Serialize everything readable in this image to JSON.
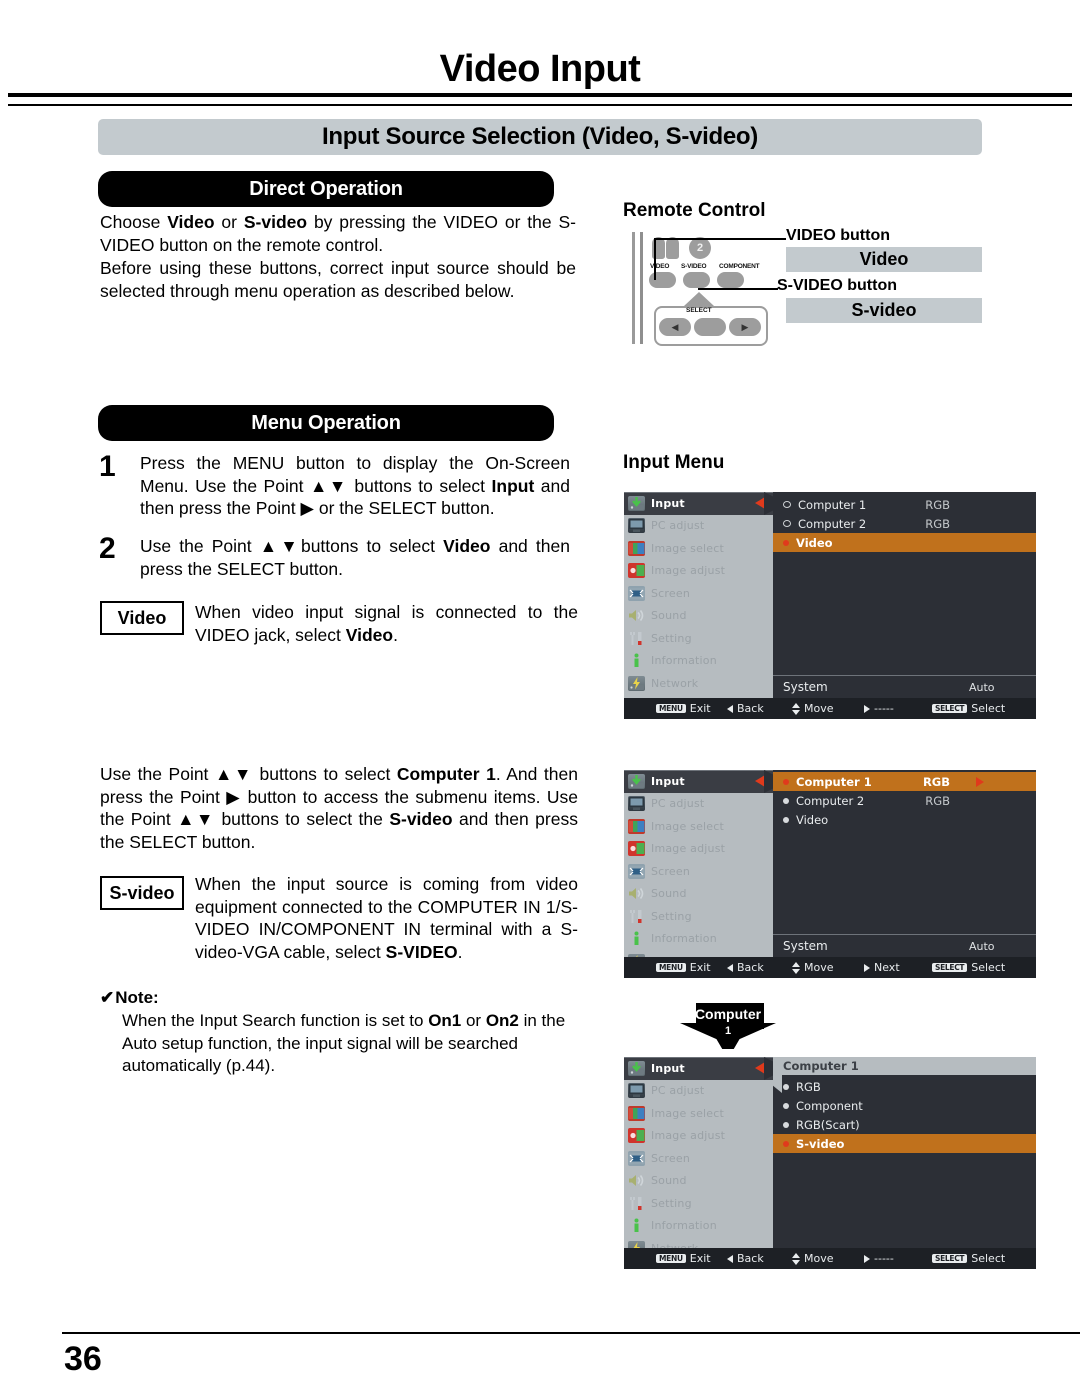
{
  "header": {
    "title": "Video Input",
    "section": "Input Source Selection (Video, S-video)"
  },
  "direct_operation": {
    "heading": "Direct Operation",
    "paragraph_1_a": "Choose ",
    "paragraph_1_b": "Video",
    "paragraph_1_c": " or ",
    "paragraph_1_d": "S-video",
    "paragraph_1_e": " by pressing the VIDEO or the S-VIDEO button on the remote control.",
    "paragraph_2": "Before using these buttons, correct input source should be selected through menu operation as described below."
  },
  "menu_operation": {
    "heading": "Menu Operation",
    "step1_num": "1",
    "step1_a": "Press the MENU button to display the On-Screen Menu. Use the Point ",
    "step1_updown": "▲▼",
    "step1_b": " buttons to select ",
    "step1_bold": "Input",
    "step1_c": " and then press the Point ",
    "step1_right": "▶",
    "step1_d": " or the SELECT button.",
    "step2_num": "2",
    "step2_a": "Use the Point ",
    "step2_updown": "▲▼",
    "step2_b": "buttons to select ",
    "step2_bold": "Video",
    "step2_c": " and then press the SELECT button."
  },
  "video_note": {
    "label": "Video",
    "text_a": "When video input signal is connected to the VIDEO jack, select ",
    "text_bold": "Video",
    "text_b": "."
  },
  "lower_paragraph": {
    "a": "Use the Point ",
    "updown1": "▲▼",
    "b": " buttons to select ",
    "bold1": "Computer 1",
    "c": ". And then press the Point ",
    "right": "▶",
    "d": " button to access the submenu items. Use the Point ",
    "updown2": "▲▼",
    "e": " buttons to select the ",
    "bold2": "S-video",
    "f": " and then press the SELECT button."
  },
  "svideo_note": {
    "label": "S-video",
    "text_a": "When the input source is coming from video equipment connected to the COMPUTER IN 1/S-VIDEO IN/COMPONENT IN terminal with a S-video-VGA cable, select ",
    "text_bold": "S-VIDEO",
    "text_b": "."
  },
  "note": {
    "check": "✔",
    "heading": "Note:",
    "body_a": "When the Input Search function is set to ",
    "bold1": "On1",
    "body_b": " or ",
    "bold2": "On2",
    "body_c": " in the Auto setup function, the input signal will be searched automatically (p.44)."
  },
  "remote_control": {
    "heading": "Remote Control",
    "video_button_label": "VIDEO button",
    "svideo_button_label": "S-VIDEO button",
    "video_box": "Video",
    "svideo_box": "S-video",
    "btn_video": "VIDEO",
    "btn_svideo": "S-VIDEO",
    "btn_component": "COMPONENT",
    "btn_two": "2",
    "select_label": "SELECT"
  },
  "input_menu": {
    "heading": "Input Menu",
    "sidebar": [
      {
        "label": "Input",
        "icon": "input-icon"
      },
      {
        "label": "PC adjust",
        "icon": "pc-adjust-icon"
      },
      {
        "label": "Image select",
        "icon": "image-select-icon"
      },
      {
        "label": "Image adjust",
        "icon": "image-adjust-icon"
      },
      {
        "label": "Screen",
        "icon": "screen-icon"
      },
      {
        "label": "Sound",
        "icon": "sound-icon"
      },
      {
        "label": "Setting",
        "icon": "setting-icon"
      },
      {
        "label": "Information",
        "icon": "information-icon"
      },
      {
        "label": "Network",
        "icon": "network-icon"
      }
    ],
    "menu1": {
      "rows": [
        {
          "label": "Computer 1",
          "value": "RGB",
          "selected": false,
          "dot": "hollow"
        },
        {
          "label": "Computer 2",
          "value": "RGB",
          "selected": false,
          "dot": "hollow"
        },
        {
          "label": "Video",
          "value": "",
          "selected": true,
          "dot": "red"
        }
      ],
      "system_label": "System",
      "system_value": "Auto",
      "footer": {
        "exit_key": "MENU",
        "exit": "Exit",
        "back": "Back",
        "move": "Move",
        "next": "-----",
        "select_key": "SELECT",
        "select": "Select"
      }
    },
    "menu2": {
      "rows": [
        {
          "label": "Computer 1",
          "value": "RGB",
          "selected": true,
          "dot": "red"
        },
        {
          "label": "Computer 2",
          "value": "RGB",
          "selected": false,
          "dot": "white"
        },
        {
          "label": "Video",
          "value": "",
          "selected": false,
          "dot": "white"
        }
      ],
      "system_label": "System",
      "system_value": "Auto",
      "footer": {
        "exit_key": "MENU",
        "exit": "Exit",
        "back": "Back",
        "move": "Move",
        "next": "Next",
        "select_key": "SELECT",
        "select": "Select"
      }
    },
    "menu3": {
      "submenu_title": "Computer 1",
      "rows": [
        {
          "label": "RGB",
          "selected": false,
          "dot": "white"
        },
        {
          "label": "Component",
          "selected": false,
          "dot": "white"
        },
        {
          "label": "RGB(Scart)",
          "selected": false,
          "dot": "white"
        },
        {
          "label": "S-video",
          "selected": true,
          "dot": "red"
        }
      ],
      "footer": {
        "exit_key": "MENU",
        "exit": "Exit",
        "back": "Back",
        "move": "Move",
        "next": "-----",
        "select_key": "SELECT",
        "select": "Select"
      }
    },
    "callout": {
      "line1": "Computer",
      "line2": "1"
    }
  },
  "footer": {
    "page_number": "36"
  },
  "colors": {
    "banner_gray": "#c3cace",
    "osd_bg": "#2c2f36",
    "osd_sidebar": "#b6bcc0",
    "highlight_orange": "#c0711c",
    "accent_red": "#e03a1c",
    "footer_bar": "#1d2025"
  }
}
